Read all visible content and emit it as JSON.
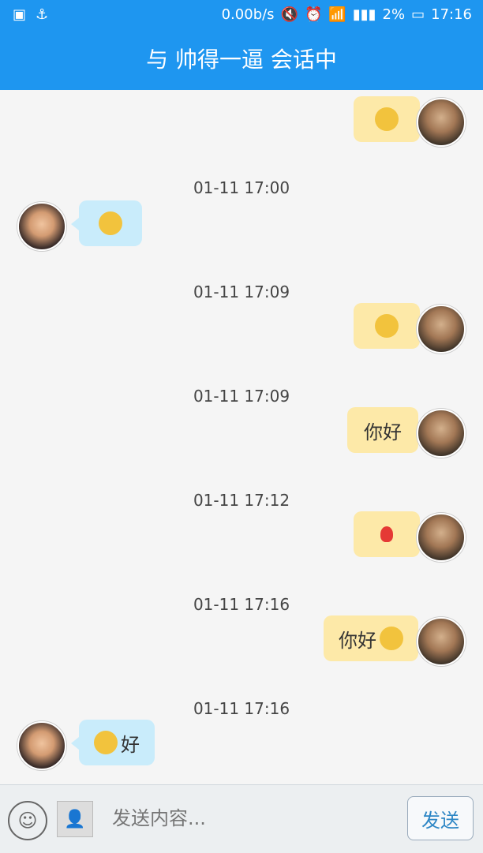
{
  "status": {
    "speed": "0.00b/s",
    "battery": "2%",
    "time": "17:16"
  },
  "title": "与 帅得一逼 会话中",
  "messages": [
    {
      "side": "out",
      "content": "emoji",
      "emoji": "thinking-emoji"
    },
    {
      "timestamp": "01-11 17:00",
      "side": "in",
      "content": "emoji",
      "emoji": "heart-eyes-emoji"
    },
    {
      "timestamp": "01-11 17:09",
      "side": "out",
      "content": "emoji",
      "emoji": "grin-emoji"
    },
    {
      "timestamp": "01-11 17:09",
      "side": "out",
      "text": "你好"
    },
    {
      "timestamp": "01-11 17:12",
      "side": "out",
      "content": "emoji",
      "emoji": "rose-emoji"
    },
    {
      "timestamp": "01-11 17:16",
      "side": "out",
      "text": "你好",
      "emoji": "grin-emoji"
    },
    {
      "timestamp": "01-11 17:16",
      "side": "in",
      "text": "好",
      "emoji": "grin-emoji"
    }
  ],
  "input": {
    "placeholder": "发送内容..."
  },
  "send_label": "发送",
  "colors": {
    "header": "#1e96f0",
    "out_bubble": "#fde9a8",
    "in_bubble": "#c9ecfb"
  }
}
